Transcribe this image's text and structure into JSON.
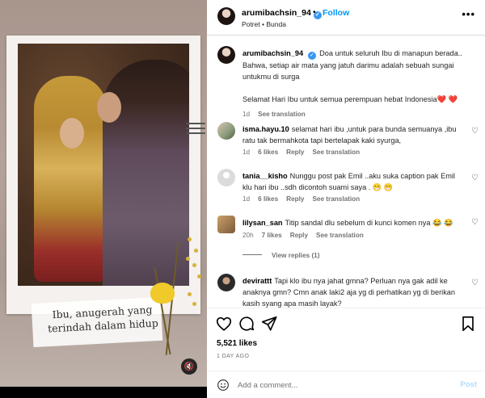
{
  "author": {
    "username": "arumibachsin_94",
    "verified_icon": "verified-badge-icon",
    "follow_label": "Follow",
    "location_line": "Potret • Bunda"
  },
  "media": {
    "caption_line1": "Ibu, anugerah yang",
    "caption_line2": "terindah dalam hidup",
    "mute_icon": "speaker-muted-icon"
  },
  "caption": {
    "username": "arumibachsin_94",
    "text": "Doa untuk seluruh Ibu di manapun berada.. Bahwa, setiap air mata yang jatuh darimu adalah sebuah sungai untukmu di surga",
    "text2": "Selamat Hari Ibu untuk semua perempuan hebat Indonesia❤️ ❤️",
    "age": "1d",
    "see_translation": "See translation"
  },
  "comments": [
    {
      "username": "isma.hayu.10",
      "text": "selamat hari ibu ,untuk para bunda semuanya ,ibu ratu tak bermahkota tapi bertelapak kaki syurga,",
      "age": "1d",
      "likes": "6 likes",
      "reply": "Reply",
      "translate": "See translation"
    },
    {
      "username": "tania__kisho",
      "text": "Nunggu post pak Emil ..aku suka caption pak Emil klu hari ibu ..sdh dicontoh suami saya . 😁 😁",
      "age": "1d",
      "likes": "6 likes",
      "reply": "Reply",
      "translate": "See translation"
    },
    {
      "username": "lilysan_san",
      "text": "Titip sandal dlu sebelum di kunci komen nya 😂 😂",
      "age": "20h",
      "likes": "7 likes",
      "reply": "Reply",
      "translate": "See translation",
      "view_replies": "View replies (1)"
    },
    {
      "username": "devirattt",
      "text": "Tapi klo ibu nya jahat gmna? Perluan nya gak adil ke anaknya gmn? Cmn anak laki2 aja yg di perhatikan yg di berikan kasih syang apa masih layak?",
      "age": "",
      "likes": "",
      "reply": "",
      "translate": ""
    }
  ],
  "stats": {
    "likes": "5,521 likes",
    "date": "1 DAY AGO"
  },
  "composer": {
    "placeholder": "Add a comment...",
    "post_label": "Post"
  },
  "colors": {
    "accent": "#0095f6",
    "muted": "#737373",
    "verified": "#3897f0"
  }
}
